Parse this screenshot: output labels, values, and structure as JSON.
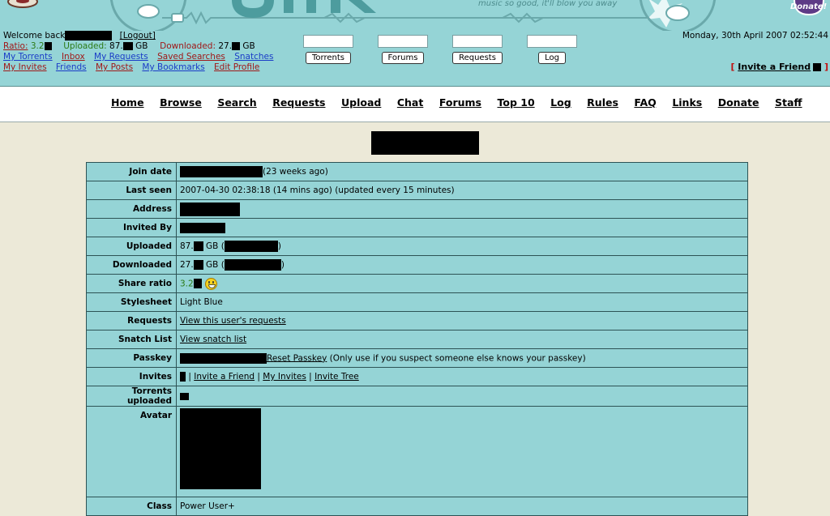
{
  "header": {
    "tagline": "music so good, it'll blow you away",
    "donate": "Donate!",
    "welcome": "Welcome back",
    "logout": "[Logout]",
    "ratio_label": "Ratio:",
    "ratio_value": "3.2",
    "uploaded_label": "Uploaded:",
    "uploaded_value": "87.",
    "downloaded_label": "Downloaded:",
    "downloaded_value": "27.",
    "unit": "GB",
    "links_row1": [
      "My Torrents",
      "Inbox",
      "My Requests",
      "Saved Searches",
      "Snatches"
    ],
    "links_row2": [
      "My Invites",
      "Friends",
      "My Posts",
      "My Bookmarks",
      "Edit Profile"
    ],
    "datetime": "Monday, 30th April 2007 02:52:44",
    "invite_friend": "Invite a Friend"
  },
  "quick_search": [
    {
      "button": "Torrents"
    },
    {
      "button": "Forums"
    },
    {
      "button": "Requests"
    },
    {
      "button": "Log"
    }
  ],
  "nav": [
    "Home",
    "Browse",
    "Search",
    "Requests",
    "Upload",
    "Chat",
    "Forums",
    "Top 10",
    "Log",
    "Rules",
    "FAQ",
    "Links",
    "Donate",
    "Staff"
  ],
  "profile": {
    "labels": {
      "join_date": "Join date",
      "last_seen": "Last seen",
      "address": "Address",
      "invited_by": "Invited By",
      "uploaded": "Uploaded",
      "downloaded": "Downloaded",
      "share_ratio": "Share ratio",
      "stylesheet": "Stylesheet",
      "requests": "Requests",
      "snatch_list": "Snatch List",
      "passkey": "Passkey",
      "invites": "Invites",
      "torrents_uploaded": "Torrents uploaded",
      "avatar": "Avatar",
      "class": "Class"
    },
    "join_date_suffix": "(23 weeks ago)",
    "last_seen": "2007-04-30 02:38:18 (14 mins ago)  (updated every 15 minutes)",
    "uploaded_value": "87.",
    "downloaded_value": "27.",
    "unit": "GB",
    "share_ratio": "3.2",
    "stylesheet": "Light Blue",
    "requests_link": "View this user's requests",
    "snatch_link": "View snatch list",
    "reset_passkey": "Reset Passkey",
    "passkey_note": "(Only use if you suspect someone else knows your passkey)",
    "invite_links": [
      "Invite a Friend",
      "My Invites",
      "Invite Tree"
    ],
    "class": "Power User+"
  }
}
